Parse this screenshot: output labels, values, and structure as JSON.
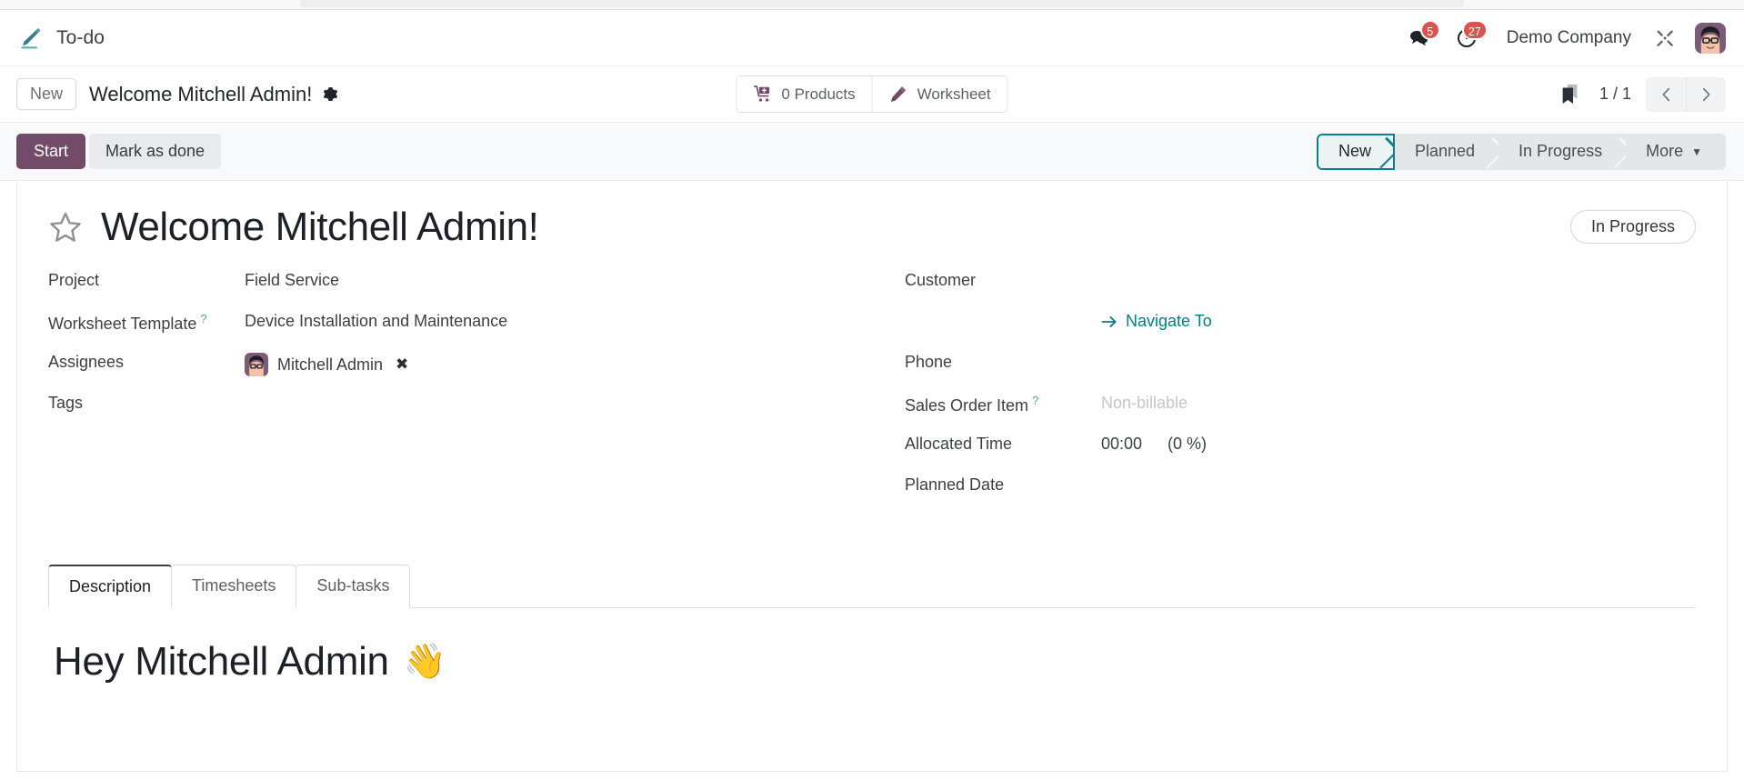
{
  "navbar": {
    "app_name": "To-do",
    "app_icon": "pencil-todo-icon",
    "messages_icon": "chat-bubbles-icon",
    "messages_badge": "5",
    "activities_icon": "clock-icon",
    "activities_badge": "27",
    "company": "Demo Company",
    "tools_icon": "wrench-screwdriver-icon",
    "avatar_icon": "user-avatar"
  },
  "breadcrumb": {
    "new_button": "New",
    "record_title": "Welcome Mitchell Admin!",
    "settings_icon": "gear-icon"
  },
  "stat_buttons": [
    {
      "label": "0 Products",
      "icon": "cart-plus-icon"
    },
    {
      "label": "Worksheet",
      "icon": "pencil-icon"
    }
  ],
  "pager": {
    "bookmark_icon": "bookmark-icon",
    "count": "1 / 1",
    "prev_icon": "chevron-left-icon",
    "next_icon": "chevron-right-icon"
  },
  "actions": {
    "start": "Start",
    "mark_as_done": "Mark as done"
  },
  "statusbar": {
    "items": [
      "New",
      "Planned",
      "In Progress"
    ],
    "active": "New",
    "more_label": "More",
    "more_caret_icon": "caret-down-icon"
  },
  "record": {
    "star_icon": "star-outline-icon",
    "title": "Welcome Mitchell Admin!",
    "state_badge": "In Progress"
  },
  "form": {
    "left": [
      {
        "label": "Project",
        "help": false,
        "value": "Field Service",
        "type": "text"
      },
      {
        "label": "Worksheet Template",
        "help": true,
        "value": "Device Installation and Maintenance",
        "type": "text"
      },
      {
        "label": "Assignees",
        "help": false,
        "value": "Mitchell Admin",
        "type": "tag",
        "remove_icon": "remove-tag-icon"
      },
      {
        "label": "Tags",
        "help": false,
        "value": "",
        "type": "text"
      }
    ],
    "right": [
      {
        "label": "Customer",
        "help": false,
        "value": "",
        "type": "text"
      },
      {
        "label": "",
        "help": false,
        "value": "Navigate To",
        "type": "link",
        "icon": "arrow-right-icon"
      },
      {
        "label": "Phone",
        "help": false,
        "value": "",
        "type": "text"
      },
      {
        "label": "Sales Order Item",
        "help": true,
        "value": "Non-billable",
        "type": "placeholder"
      },
      {
        "label": "Allocated Time",
        "help": false,
        "value": "00:00",
        "extra": "(0 %)",
        "type": "duration"
      },
      {
        "label": "Planned Date",
        "help": false,
        "value": "",
        "type": "text"
      }
    ]
  },
  "notebook": {
    "tabs": [
      "Description",
      "Timesheets",
      "Sub-tasks"
    ],
    "active_tab": "Description",
    "description": {
      "heading": "Hey Mitchell Admin",
      "heading_emoji": "👋"
    }
  },
  "colors": {
    "primary": "#714b67",
    "accent_teal": "#017e84",
    "badge_red": "#d9534f",
    "status_active_bg": "#eaf4f5"
  }
}
